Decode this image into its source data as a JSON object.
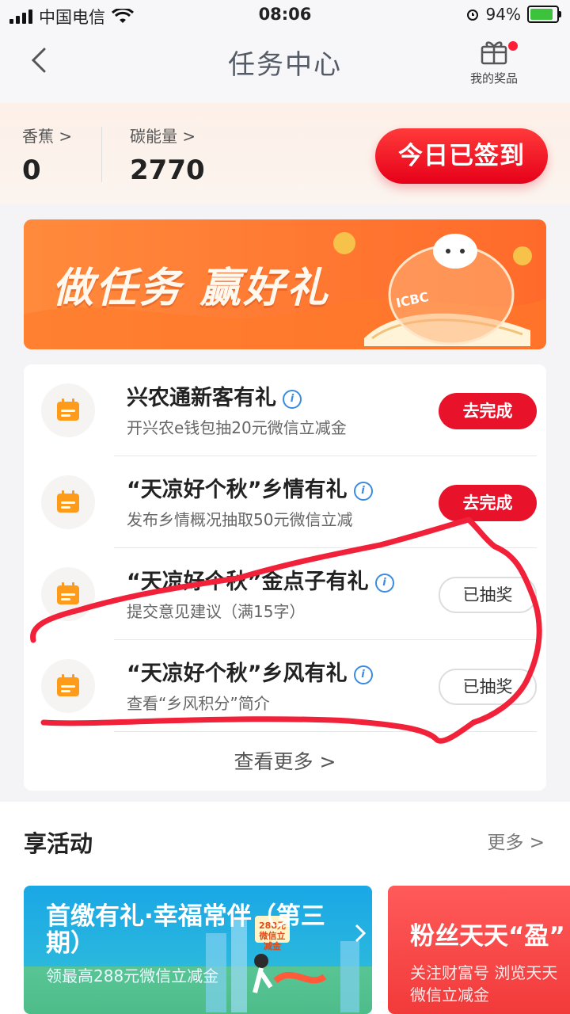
{
  "status_bar": {
    "carrier": "中国电信",
    "time": "08:06",
    "battery": "94%"
  },
  "header": {
    "title": "任务中心",
    "prize_label": "我的奖品"
  },
  "summary": {
    "banana_label": "香蕉 >",
    "banana_value": "0",
    "carbon_label": "碳能量 >",
    "carbon_value": "2770",
    "signin_label": "今日已签到"
  },
  "banner": {
    "text": "做任务 赢好礼",
    "logo_text": "ICBC"
  },
  "tasks": [
    {
      "title": "兴农通新客有礼",
      "desc": "开兴农e钱包抽20元微信立减金",
      "action": "去完成"
    },
    {
      "title": "“天凉好个秋”乡情有礼",
      "desc": "发布乡情概况抽取50元微信立减",
      "action": "去完成"
    },
    {
      "title": "“天凉好个秋”金点子有礼",
      "desc": "提交意见建议（满15字）",
      "action": "已抽奖"
    },
    {
      "title": "“天凉好个秋”乡风有礼",
      "desc": "查看“乡风积分”简介",
      "action": "已抽奖"
    }
  ],
  "tasks_more": "查看更多 >",
  "activities": {
    "title": "享活动",
    "more": "更多 >",
    "cards": [
      {
        "title": "首缴有礼·幸福常伴（第三期）",
        "sub": "领最高288元微信立减金",
        "badge": "288元 微信立减金"
      },
      {
        "title": "粉丝天天“盈”",
        "sub_line1": "关注财富号 浏览天天",
        "sub_line2": "微信立减金"
      }
    ]
  },
  "colors": {
    "accent_red": "#e8132a",
    "banner_orange": "#ff7a30",
    "annotation_red": "#f2213a"
  }
}
